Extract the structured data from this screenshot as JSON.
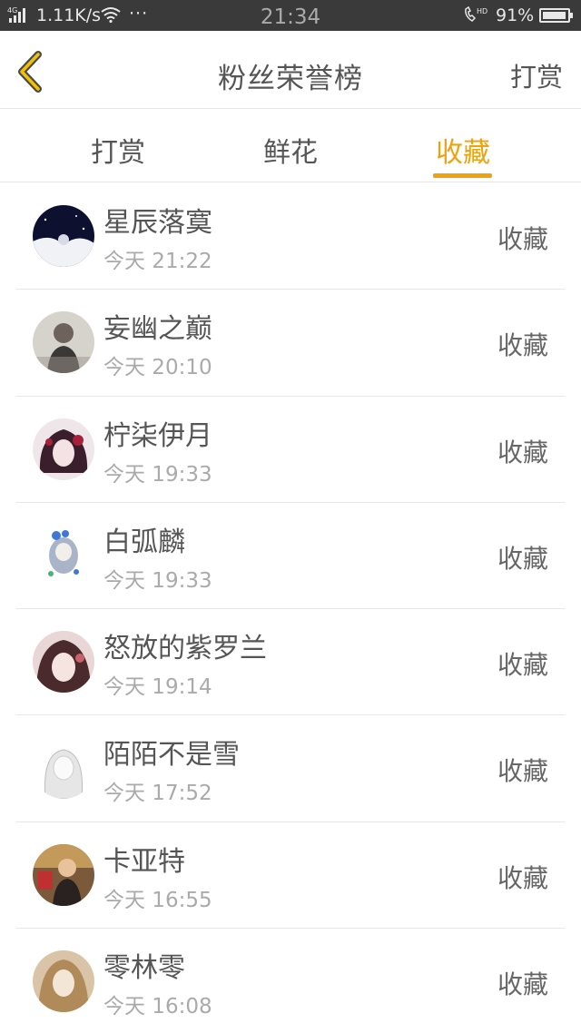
{
  "status_bar": {
    "network": "4G",
    "speed": "1.11K/s",
    "more": "···",
    "time": "21:34",
    "battery": "91%",
    "battery_level": 0.91
  },
  "header": {
    "title": "粉丝荣誉榜",
    "action": "打赏"
  },
  "tabs": [
    {
      "label": "打赏",
      "active": false
    },
    {
      "label": "鲜花",
      "active": false
    },
    {
      "label": "收藏",
      "active": true
    }
  ],
  "accent_color": "#f0a20a",
  "entries": [
    {
      "name": "星辰落寞",
      "time": "今天 21:22",
      "type": "收藏"
    },
    {
      "name": "妄幽之巅",
      "time": "今天 20:10",
      "type": "收藏"
    },
    {
      "name": "柠柒伊月",
      "time": "今天 19:33",
      "type": "收藏"
    },
    {
      "name": "白弧麟",
      "time": "今天 19:33",
      "type": "收藏"
    },
    {
      "name": "怒放的紫罗兰",
      "time": "今天 19:14",
      "type": "收藏"
    },
    {
      "name": "陌陌不是雪",
      "time": "今天 17:52",
      "type": "收藏"
    },
    {
      "name": "卡亚特",
      "time": "今天 16:55",
      "type": "收藏"
    },
    {
      "name": "零林零",
      "time": "今天 16:08",
      "type": "收藏"
    }
  ]
}
